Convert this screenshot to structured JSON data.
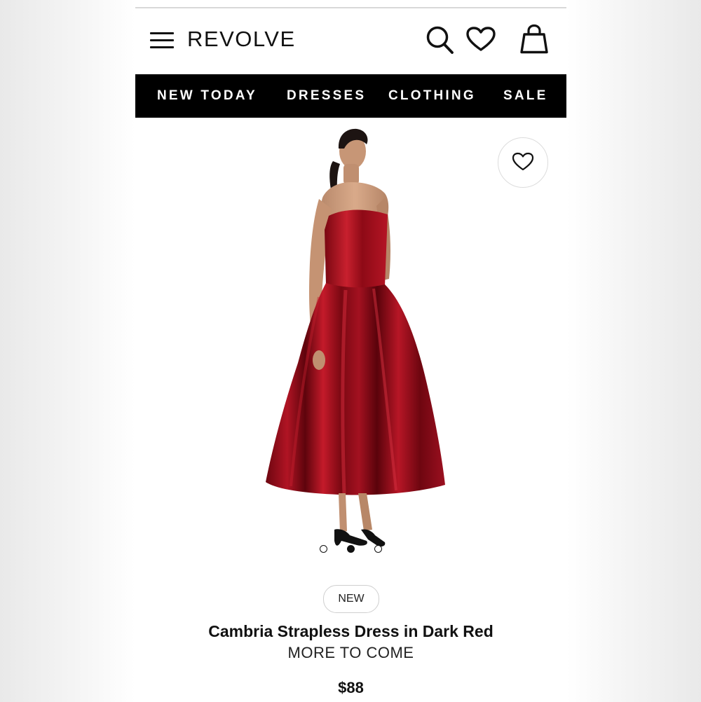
{
  "header": {
    "brand": "REVOLVE",
    "icons": [
      "menu-icon",
      "search-icon",
      "heart-icon",
      "shopping-bag-icon"
    ]
  },
  "nav": {
    "items": [
      {
        "label": "NEW TODAY"
      },
      {
        "label": "DRESSES"
      },
      {
        "label": "CLOTHING"
      },
      {
        "label": "SALE"
      }
    ]
  },
  "gallery": {
    "image_count": 3,
    "active_index": 1
  },
  "product": {
    "badge": "NEW",
    "name": "Cambria Strapless Dress in Dark Red",
    "brand": "MORE TO COME",
    "price": "$88"
  },
  "colors": {
    "nav_background": "#000000",
    "dress_red": "#8e0a16",
    "text": "#111111"
  }
}
